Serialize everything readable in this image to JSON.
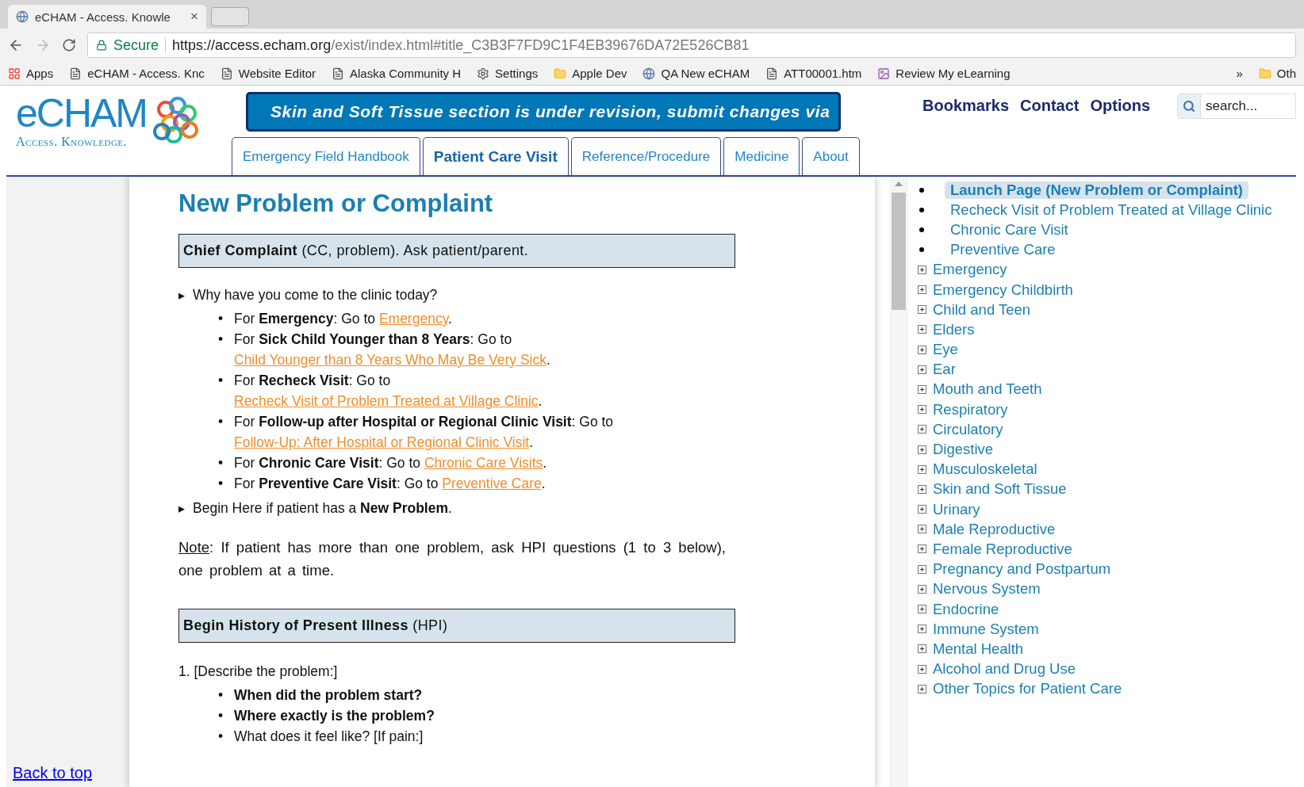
{
  "browser": {
    "tab_title": "eCHAM - Access. Knowle",
    "close": "×",
    "secure": "Secure",
    "url_host": "https://access.echam.org",
    "url_path": "/exist/index.html#title_C3B3F7FD9C1F4EB39676DA72E526CB81",
    "bookmarks": [
      {
        "label": "Apps",
        "kind": "apps"
      },
      {
        "label": "eCHAM - Access. Knc",
        "kind": "page"
      },
      {
        "label": "Website Editor",
        "kind": "page"
      },
      {
        "label": "Alaska Community H",
        "kind": "page"
      },
      {
        "label": "Settings",
        "kind": "gear"
      },
      {
        "label": "Apple Dev",
        "kind": "folder"
      },
      {
        "label": "QA New eCHAM",
        "kind": "globe"
      },
      {
        "label": "ATT00001.htm",
        "kind": "page"
      },
      {
        "label": "Review My eLearning",
        "kind": "app"
      }
    ],
    "more": "»",
    "other": "Oth"
  },
  "logo": {
    "name": "eCHAM",
    "tagline": "Access. Knowledge."
  },
  "banner": "Skin and Soft Tissue section is under revision, submit changes via",
  "top_links": [
    "Bookmarks",
    "Contact",
    "Options"
  ],
  "search": {
    "placeholder": "search..."
  },
  "tabs": [
    {
      "label": "Emergency Field Handbook",
      "selected": false
    },
    {
      "label": "Patient Care Visit",
      "selected": true
    },
    {
      "label": "Reference/Procedure",
      "selected": false
    },
    {
      "label": "Medicine",
      "selected": false
    },
    {
      "label": "About",
      "selected": false
    }
  ],
  "content": {
    "title": "New Problem or Complaint",
    "section_1": "**Chief Complaint** (CC, problem). Ask patient/parent.",
    "arrow": "▸",
    "bullet": "•",
    "question": "Why have you come to the clinic today?",
    "options": [
      {
        "lead": "For **Emergency**: Go to ",
        "link": "Emergency",
        "tail": "."
      },
      {
        "lead": "For **Sick Child Younger than 8 Years**: Go to ",
        "link": "Child Younger than 8 Years Who May Be Very Sick",
        "tail": "."
      },
      {
        "lead": "For **Recheck Visit**: Go to ",
        "link": "Recheck Visit of Problem Treated at Village Clinic",
        "tail": "."
      },
      {
        "lead": "For **Follow-up after Hospital or Regional Clinic Visit**: Go to ",
        "link": "Follow-Up: After Hospital or Regional Clinic Visit",
        "tail": "."
      },
      {
        "lead": "For **Chronic Care Visit**: Go to ",
        "link": "Chronic Care Visits",
        "tail": "."
      },
      {
        "lead": "For **Preventive Care Visit**: Go to ",
        "link": "Preventive Care",
        "tail": "."
      }
    ],
    "begin": "Begin Here if patient has a **New Problem**.",
    "note_label": "Note",
    "note": ": If patient has more than one problem, ask HPI questions (1 to 3 below), one problem at a time.",
    "section_2": "**Begin History of Present Illness** (HPI)",
    "step": "1. [Describe the problem:]",
    "step_items": [
      {
        "text": "When did the problem start?",
        "bold": true
      },
      {
        "text": "Where exactly is the problem?",
        "bold": true
      },
      {
        "text": "What does it feel like? [If pain:]",
        "bold": false
      }
    ]
  },
  "back_to_top": "Back to top",
  "sidebar": {
    "pages": [
      {
        "label": "Launch Page (New Problem or Complaint)",
        "selected": true
      },
      {
        "label": "Recheck Visit of Problem Treated at Village Clinic",
        "selected": false
      },
      {
        "label": "Chronic Care Visit",
        "selected": false
      },
      {
        "label": "Preventive Care",
        "selected": false
      }
    ],
    "topics": [
      {
        "label": "Emergency",
        "expanded": false
      },
      {
        "label": "Emergency Childbirth",
        "expanded": false
      },
      {
        "label": "Child and Teen",
        "expanded": false
      },
      {
        "label": "Elders",
        "expanded": false
      },
      {
        "label": "Eye",
        "expanded": false
      },
      {
        "label": "Ear",
        "expanded": false
      },
      {
        "label": "Mouth and Teeth",
        "expanded": false
      },
      {
        "label": "Respiratory",
        "expanded": false
      },
      {
        "label": "Circulatory",
        "expanded": false
      },
      {
        "label": "Digestive",
        "expanded": false
      },
      {
        "label": "Musculoskeletal",
        "expanded": false
      },
      {
        "label": "Skin and Soft Tissue",
        "expanded": false
      },
      {
        "label": "Urinary",
        "expanded": false
      },
      {
        "label": "Male Reproductive",
        "expanded": false
      },
      {
        "label": "Female Reproductive",
        "expanded": false
      },
      {
        "label": "Pregnancy and Postpartum",
        "expanded": false
      },
      {
        "label": "Nervous System",
        "expanded": false
      },
      {
        "label": "Endocrine",
        "expanded": false
      },
      {
        "label": "Immune System",
        "expanded": false
      },
      {
        "label": "Mental Health",
        "expanded": false
      },
      {
        "label": "Alcohol and Drug Use",
        "expanded": false
      },
      {
        "label": "Other Topics for Patient Care",
        "expanded": false
      }
    ]
  }
}
